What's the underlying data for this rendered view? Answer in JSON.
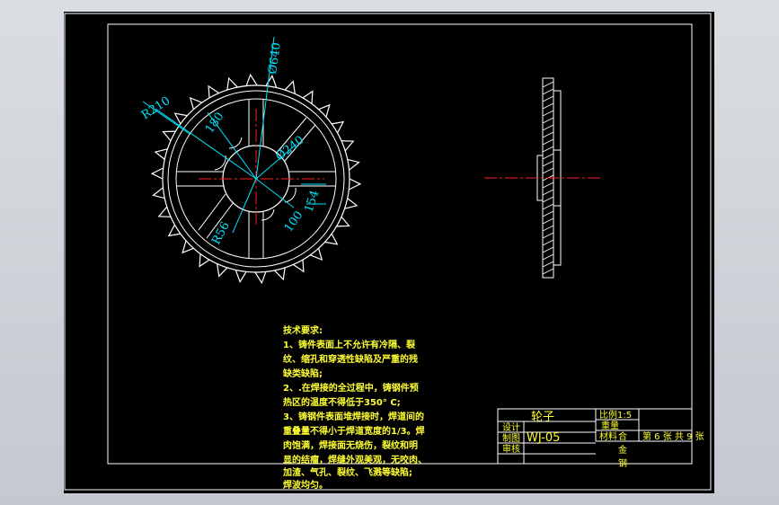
{
  "drawing": {
    "dimensions": {
      "outer_dia": "Ø640",
      "outer_radius": "R210",
      "slot_width": "180",
      "hub_dia": "Ø240",
      "keyway": "154",
      "spoke_width": "100",
      "fillet_radius": "R56"
    },
    "technical_requirements": {
      "heading": "技术要求:",
      "lines": [
        "1、铸件表面上不允许有冷隔、裂",
        "纹、缩孔和穿透性缺陷及严重的残",
        "缺类缺陷;",
        "2、.在焊接的全过程中，铸钢件预",
        "热区的温度不得低于350° C;",
        "3、铸钢件表面堆焊接时，焊道间的",
        "重叠量不得小于焊道宽度的1/3。焊",
        "肉饱满，焊接面无烧伤，裂纹和明",
        "显的结瘤，焊缝外观美观，无咬肉、",
        "加渣、气孔、裂纹、飞溅等缺陷;",
        "焊波均匀。"
      ]
    },
    "title_block": {
      "part_name": "轮子",
      "scale": "比例1:5",
      "weight": "重量",
      "material": "材料",
      "drawing_no": "WJ-05",
      "design": "设计",
      "draw": "制图",
      "review": "审核",
      "material_value_1": "合",
      "material_value_2": "金",
      "material_value_3": "钢",
      "sheet": "第 6 张 共 9 张"
    }
  },
  "colors": {
    "background": "#000000",
    "outline": "#ffffff",
    "dimension": "#00e5ff",
    "centerline": "#ff2020",
    "annotation": "#ffff33"
  }
}
